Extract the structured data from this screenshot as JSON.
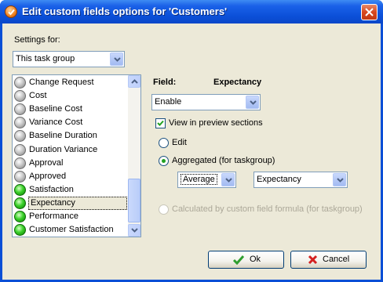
{
  "window": {
    "title": "Edit custom fields options for  'Customers'"
  },
  "settings": {
    "label": "Settings for:",
    "selected": "This task group"
  },
  "fields_list": {
    "items": [
      {
        "label": "Change Request",
        "status": "grey"
      },
      {
        "label": "Cost",
        "status": "grey"
      },
      {
        "label": "Baseline Cost",
        "status": "grey"
      },
      {
        "label": "Variance Cost",
        "status": "grey"
      },
      {
        "label": "Baseline Duration",
        "status": "grey"
      },
      {
        "label": "Duration Variance",
        "status": "grey"
      },
      {
        "label": "Approval",
        "status": "grey"
      },
      {
        "label": "Approved",
        "status": "grey"
      },
      {
        "label": "Satisfaction",
        "status": "green"
      },
      {
        "label": "Expectancy",
        "status": "green",
        "selected": true
      },
      {
        "label": "Performance",
        "status": "green"
      },
      {
        "label": "Customer Satisfaction",
        "status": "green"
      }
    ]
  },
  "field": {
    "label": "Field:",
    "name": "Expectancy"
  },
  "mode": {
    "selected": "Enable"
  },
  "view_preview": {
    "label": "View in preview sections",
    "checked": true
  },
  "options": {
    "edit": "Edit",
    "aggregated": "Aggregated (for taskgroup)",
    "aggregate_function": "Average",
    "aggregate_field": "Expectancy",
    "calculated": "Calculated by custom field formula (for taskgroup)",
    "selected": "aggregated"
  },
  "buttons": {
    "ok": "Ok",
    "cancel": "Cancel"
  },
  "colors": {
    "titlebar": "#0a4fd6",
    "dialog_bg": "#ece9d8",
    "status_on": "#3bd12a",
    "status_off": "#c8c8c8",
    "disabled_text": "#aca899"
  }
}
